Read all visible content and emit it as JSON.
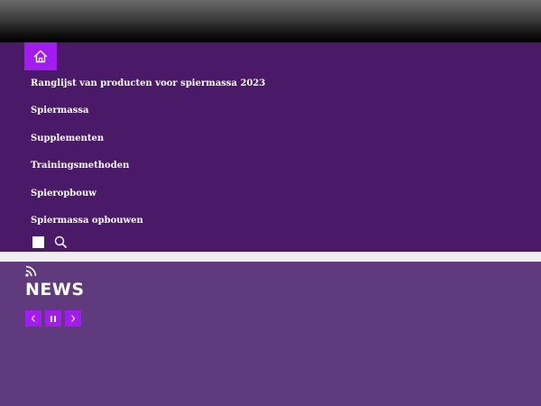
{
  "nav": {
    "home_icon": "home-icon",
    "items": [
      {
        "label": "Ranglijst van producten voor spiermassa 2023"
      },
      {
        "label": "Spiermassa"
      },
      {
        "label": "Supplementen"
      },
      {
        "label": "Trainingsmethoden"
      },
      {
        "label": "Spieropbouw"
      },
      {
        "label": "Spiermassa opbouwen"
      }
    ],
    "tools": {
      "toggle_icon": "square-icon",
      "search_icon": "search-icon"
    }
  },
  "news": {
    "feed_icon": "rss-icon",
    "title": "NEWS",
    "controls": {
      "prev_icon": "chevron-left-icon",
      "pause_icon": "pause-icon",
      "next_icon": "chevron-right-icon"
    }
  },
  "colors": {
    "topbar": "#000000",
    "nav_background": "#4a1a68",
    "accent": "#a21cf0",
    "divider": "#eeedf0",
    "news_background": "#5f3a7c",
    "text": "#ffffff"
  }
}
